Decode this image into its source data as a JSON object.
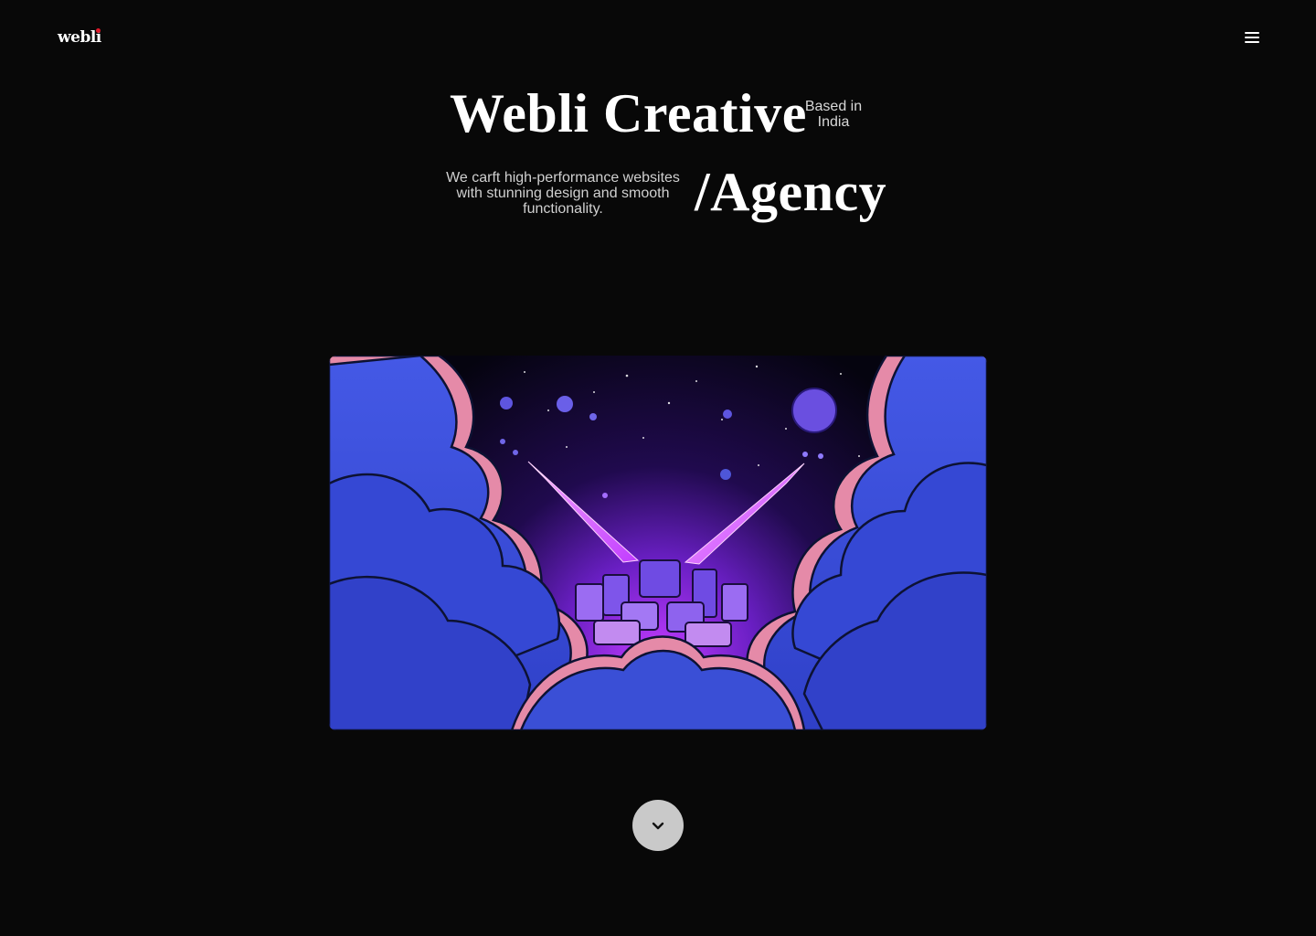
{
  "header": {
    "logo_text": "webl",
    "logo_text_i": "i",
    "menu_icon": "hamburger-menu-icon"
  },
  "hero": {
    "title": "Webli Creative",
    "location": "Based in India",
    "description": "We carft high-performance websites with stunning design and smooth functionality.",
    "agency": "/Agency"
  },
  "artwork": {
    "palette": {
      "sky": "#07061a",
      "glow": "#c23bff",
      "cloud": "#3a4fd6",
      "cloud_dark": "#2233a6",
      "rim": "#e58aa8",
      "planet": "#6a4fe0"
    }
  },
  "scroll": {
    "icon": "chevron-down-icon"
  },
  "colors": {
    "background": "#080808",
    "text": "#ffffff",
    "accent": "#e0192b",
    "button": "#c9c9c9"
  }
}
